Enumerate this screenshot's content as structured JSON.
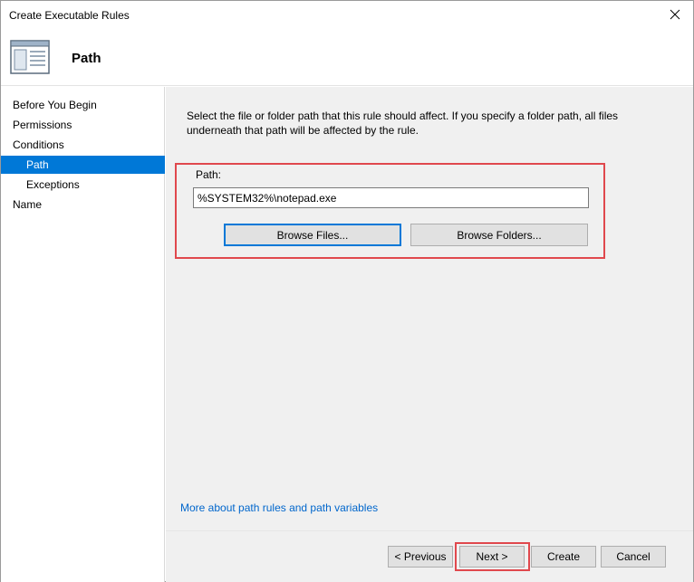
{
  "window": {
    "title": "Create Executable Rules"
  },
  "header": {
    "title": "Path",
    "icon": "wizard-page-icon"
  },
  "nav": {
    "items": [
      {
        "label": "Before You Begin",
        "active": false,
        "sub": false
      },
      {
        "label": "Permissions",
        "active": false,
        "sub": false
      },
      {
        "label": "Conditions",
        "active": false,
        "sub": false
      },
      {
        "label": "Path",
        "active": true,
        "sub": true
      },
      {
        "label": "Exceptions",
        "active": false,
        "sub": true
      },
      {
        "label": "Name",
        "active": false,
        "sub": false
      }
    ]
  },
  "main": {
    "description": "Select the file or folder path that this rule should affect. If you specify a folder path, all files underneath that path will be affected by the rule.",
    "path_label": "Path:",
    "path_value": "%SYSTEM32%\\notepad.exe",
    "browse_files_label": "Browse Files...",
    "browse_folders_label": "Browse Folders...",
    "help_link": "More about path rules and path variables"
  },
  "footer": {
    "previous_label": "< Previous",
    "next_label": "Next >",
    "create_label": "Create",
    "cancel_label": "Cancel"
  },
  "colors": {
    "accent": "#0078d7",
    "highlight": "#e0484d",
    "link": "#0066cc",
    "panel_bg": "#f0f0f0"
  }
}
